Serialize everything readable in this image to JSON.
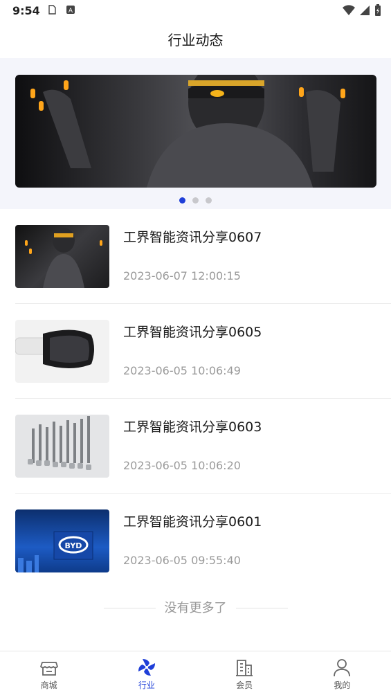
{
  "status": {
    "time": "9:54"
  },
  "header": {
    "title": "行业动态"
  },
  "banner": {
    "slide_count": 3,
    "active_slide": 1
  },
  "news": [
    {
      "title": "工界智能资讯分享0607",
      "date": "2023-06-07 12:00:15",
      "thumb": "dark-figure-with-glowing-fingers"
    },
    {
      "title": "工界智能资讯分享0605",
      "date": "2023-06-05 10:06:49",
      "thumb": "vr-headset"
    },
    {
      "title": "工界智能资讯分享0603",
      "date": "2023-06-05 10:06:20",
      "thumb": "metal-tools-set"
    },
    {
      "title": "工界智能资讯分享0601",
      "date": "2023-06-05 09:55:40",
      "thumb": "byd-logo-sign"
    }
  ],
  "footer": {
    "no_more": "没有更多了"
  },
  "tabs": [
    {
      "label": "商城",
      "icon": "store-icon"
    },
    {
      "label": "行业",
      "icon": "pinwheel-icon",
      "active": true
    },
    {
      "label": "会员",
      "icon": "building-icon"
    },
    {
      "label": "我的",
      "icon": "person-icon"
    }
  ],
  "colors": {
    "accent": "#1f3fd8",
    "muted": "#9a9a9a",
    "banner_bg": "#f4f5fb"
  }
}
